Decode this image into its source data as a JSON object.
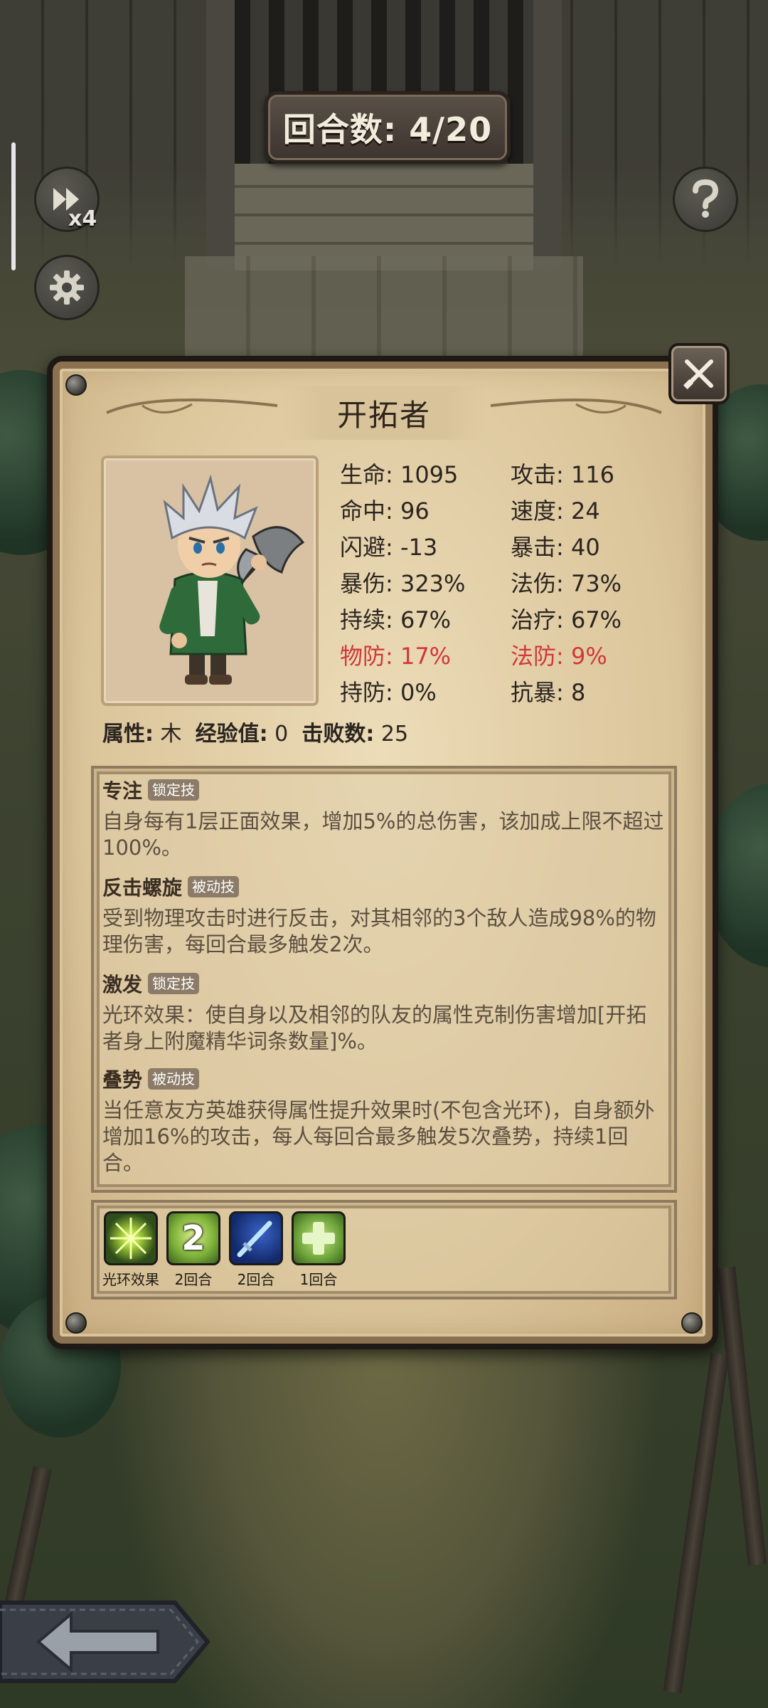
{
  "hud": {
    "round_label": "回合数: 4/20",
    "speed_label": "x4",
    "speed_icon": "fast-forward-icon",
    "settings_icon": "gear-icon",
    "help_icon": "question-icon"
  },
  "card": {
    "name": "开拓者",
    "close_icon": "crossed-swords-icon",
    "stats": [
      {
        "label": "生命: 1095"
      },
      {
        "label": "攻击: 116"
      },
      {
        "label": "命中: 96"
      },
      {
        "label": "速度: 24"
      },
      {
        "label": "闪避: -13"
      },
      {
        "label": "暴击: 40"
      },
      {
        "label": "暴伤: 323%"
      },
      {
        "label": "法伤: 73%"
      },
      {
        "label": "持续: 67%"
      },
      {
        "label": "治疗: 67%"
      },
      {
        "label": "物防: 17%",
        "color": "#d0383a"
      },
      {
        "label": "法防: 9%",
        "color": "#d0383a"
      },
      {
        "label": "持防: 0%"
      },
      {
        "label": "抗暴: 8"
      }
    ],
    "attributes": {
      "element_label": "属性:",
      "element_value": "木",
      "exp_label": "经验值:",
      "exp_value": "0",
      "kills_label": "击败数:",
      "kills_value": "25"
    },
    "skills": [
      {
        "name": "专注",
        "tag": "锁定技",
        "desc": "自身每有1层正面效果，增加5%的总伤害，该加成上限不超过100%。"
      },
      {
        "name": "反击螺旋",
        "tag": "被动技",
        "desc": "受到物理攻击时进行反击，对其相邻的3个敌人造成98%的物理伤害，每回合最多触发2次。"
      },
      {
        "name": "激发",
        "tag": "锁定技",
        "desc": "光环效果：使自身以及相邻的队友的属性克制伤害增加[开拓者身上附魔精华词条数量]%。"
      },
      {
        "name": "叠势",
        "tag": "被动技",
        "desc": "当任意友方英雄获得属性提升效果时(不包含光环)，自身额外增加16%的攻击，每人每回合最多触发5次叠势，持续1回合。"
      }
    ],
    "buffs": [
      {
        "icon": "aura-burst-icon",
        "label": "光环效果"
      },
      {
        "icon": "stack-2-icon",
        "label": "2回合",
        "stack": "2"
      },
      {
        "icon": "blue-sword-icon",
        "label": "2回合"
      },
      {
        "icon": "green-cross-icon",
        "label": "1回合"
      }
    ]
  },
  "nav": {
    "back_icon": "back-arrow-icon"
  }
}
